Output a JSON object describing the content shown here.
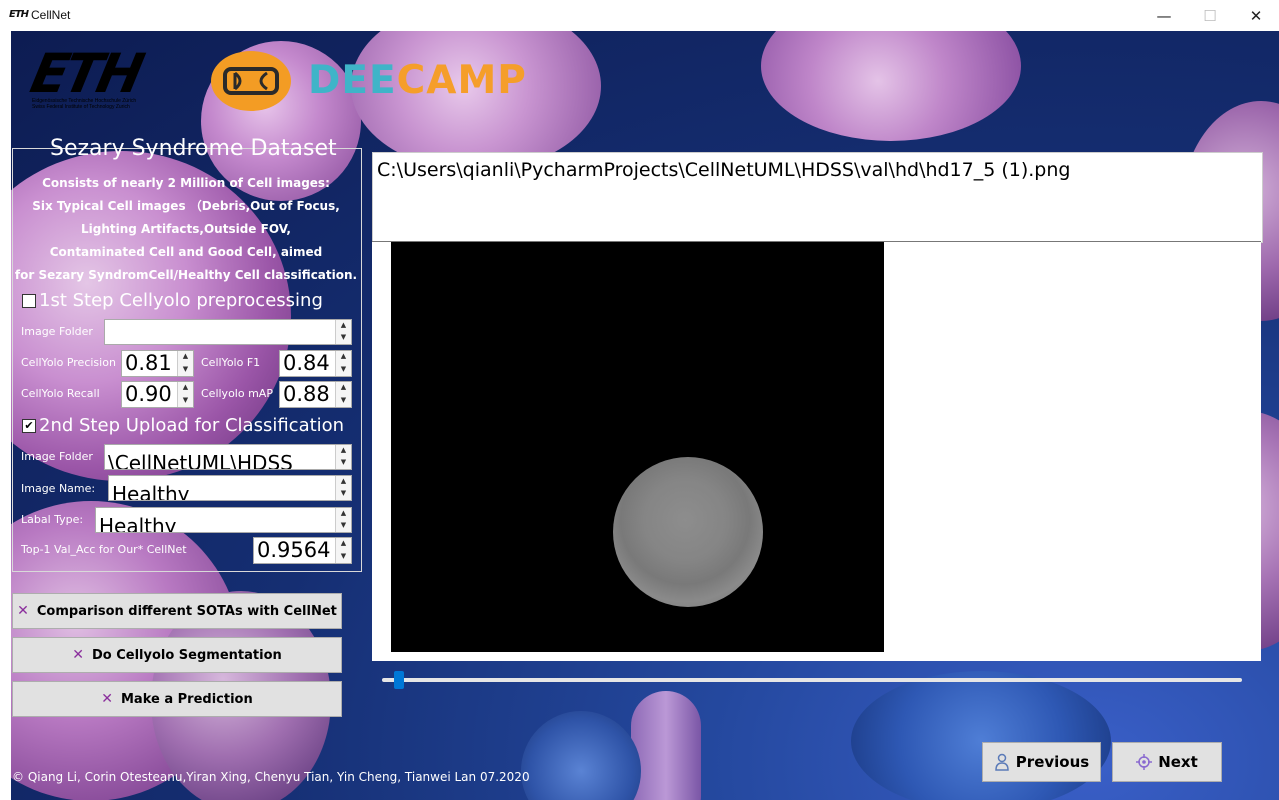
{
  "window": {
    "title": "CellNet",
    "app_icon_text": "ETH",
    "minimize": "—",
    "maximize": "☐",
    "close": "✕"
  },
  "logos": {
    "eth": "ETH",
    "eth_subtitle_1": "Eidgenössische Technische Hochschule Zürich",
    "eth_subtitle_2": "Swiss Federal Institute of Technology Zurich",
    "deecamp_dee": "DEE",
    "deecamp_camp": "CAMP"
  },
  "dataset": {
    "title": "Sezary Syndrome Dataset",
    "description": [
      "Consists of nearly 2 Million of Cell images:",
      "Six  Typical  Cell  images （Debris,Out of Focus,",
      "Lighting Artifacts,Outside FOV,",
      "Contaminated Cell  and Good Cell, aimed",
      "for Sezary SyndromCell/Healthy  Cell  classification."
    ]
  },
  "step1": {
    "label": "1st Step Cellyolo preprocessing",
    "checked": false,
    "image_folder_label": "Image Folder",
    "image_folder_value": "",
    "precision_label": "CellYolo Precision",
    "precision_value": "0.81",
    "f1_label": "CellYolo F1",
    "f1_value": "0.84",
    "recall_label": "CellYolo Recall",
    "recall_value": "0.90",
    "map_label": "Cellyolo mAP",
    "map_value": "0.88"
  },
  "step2": {
    "label": "2nd Step Upload for Classification",
    "checked": true,
    "check_glyph": "✔",
    "image_folder_label": "Image Folder",
    "image_folder_value": "\\CellNetUML\\HDSS",
    "image_name_label": "Image Name:",
    "image_name_value": "Healthy",
    "label_type_label": "Labal Type:",
    "label_type_value": "Healthy",
    "acc_label": "Top-1 Val_Acc for Our* CellNet",
    "acc_value": "0.9564"
  },
  "buttons": {
    "x_glyph": "✕",
    "compare": "Comparison different SOTAs with CellNet",
    "segment": "Do Cellyolo Segmentation",
    "predict": "Make a Prediction",
    "previous": "Previous",
    "next": "Next"
  },
  "viewer": {
    "path": "C:\\Users\\qianli\\PycharmProjects\\CellNetUML\\HDSS\\val\\hd\\hd17_5 (1).png",
    "slider_position": 0.01
  },
  "footer": {
    "copyright": "© Qiang Li, Corin Otesteanu,Yiran Xing, Chenyu Tian, Yin Cheng, Tianwei Lan 07.2020"
  },
  "colors": {
    "accent": "#0078d7",
    "x_mark": "#8a2e9c",
    "deecamp_teal": "#3fb4c8",
    "deecamp_orange": "#f59e2a"
  }
}
